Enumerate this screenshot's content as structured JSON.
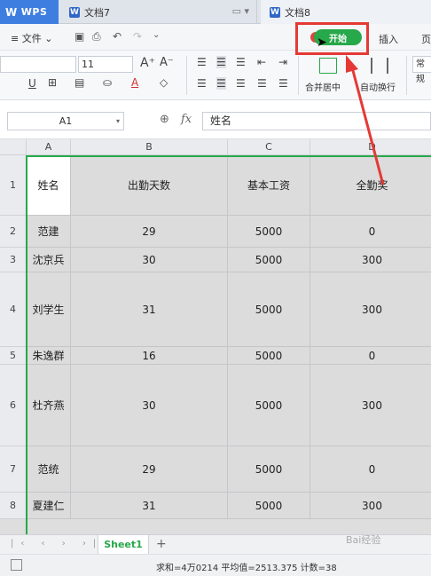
{
  "titlebar": {
    "app_name": "WPS",
    "tabs": [
      {
        "label": "文档7"
      },
      {
        "label": "文档8"
      }
    ]
  },
  "menubar": {
    "file_label": "文件",
    "start_label": "开始",
    "insert_label": "插入",
    "page_label": "页"
  },
  "ribbon": {
    "font_size": "11",
    "merge_label": "合并居中",
    "wrap_label": "自动换行",
    "normal_label": "常规"
  },
  "formula": {
    "cell_ref": "A1",
    "fx_label": "fx",
    "value": "姓名"
  },
  "sheet": {
    "columns": [
      "A",
      "B",
      "C",
      "D"
    ],
    "rows": [
      {
        "num": "1",
        "cells": [
          "姓名",
          "出勤天数",
          "基本工资",
          "全勤奖"
        ]
      },
      {
        "num": "2",
        "cells": [
          "范建",
          "29",
          "5000",
          "0"
        ]
      },
      {
        "num": "3",
        "cells": [
          "沈京兵",
          "30",
          "5000",
          "300"
        ]
      },
      {
        "num": "4",
        "cells": [
          "刘学生",
          "31",
          "5000",
          "300"
        ]
      },
      {
        "num": "5",
        "cells": [
          "朱逸群",
          "16",
          "5000",
          "0"
        ]
      },
      {
        "num": "6",
        "cells": [
          "杜齐燕",
          "30",
          "5000",
          "300"
        ]
      },
      {
        "num": "7",
        "cells": [
          "范统",
          "29",
          "5000",
          "0"
        ]
      },
      {
        "num": "8",
        "cells": [
          "夏建仁",
          "31",
          "5000",
          "300"
        ]
      }
    ]
  },
  "sheettabs": {
    "active": "Sheet1",
    "add": "+"
  },
  "status": {
    "summary": "求和=4万0214   平均值=2513.375   计数=38"
  },
  "watermark": "Bai经验"
}
